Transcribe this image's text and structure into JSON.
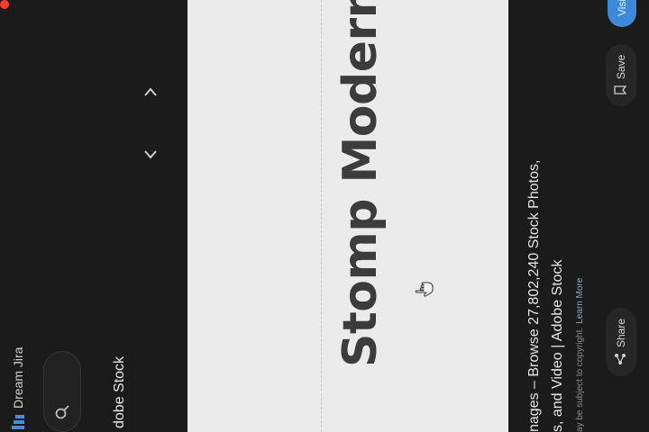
{
  "colors": {
    "background": "#1b1b1b",
    "image_background": "#ebebeb",
    "accent_blue": "#3c8ad9",
    "notification_red": "#ff3b30"
  },
  "header": {
    "brand_label": "Dream Jira",
    "brand_icon": "stacked-bars-icon",
    "search_icon": "search-icon",
    "tab_title": "dobe Stock"
  },
  "image": {
    "headline": "Stomp Modern.",
    "cursor_icon": "hand-pointer-icon",
    "prev_icon": "chevron-left-icon",
    "next_icon": "chevron-right-icon"
  },
  "caption": {
    "line1": "nages – Browse 27,802,240 Stock Photos,",
    "line2": "s, and Video | Adobe Stock",
    "notice": "ay be subject to copyright.",
    "learn_more": "Learn More"
  },
  "actions": {
    "share_label": "Share",
    "save_label": "Save",
    "visit_label": "Visi"
  }
}
